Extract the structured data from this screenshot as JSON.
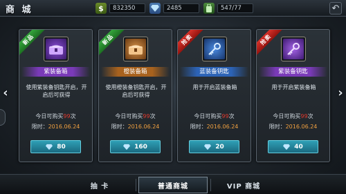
{
  "header": {
    "title": "商 城",
    "gold": "832350",
    "gems": "2485",
    "bag": "547/77",
    "gold_icon": "dollar-icon",
    "gem_icon": "diamond-icon",
    "bag_icon": "bag-icon",
    "close_glyph": "↶"
  },
  "cards": [
    {
      "ribbon": "新品",
      "name": "紫装备箱",
      "desc": "使用紫装备钥匙开启，开启后可获得",
      "quota_prefix": "今日可购买",
      "quota_num": "99",
      "quota_suffix": "次",
      "limit_label": "限时：",
      "limit_date": "2016.06.24",
      "price": "80"
    },
    {
      "ribbon": "新品",
      "name": "橙装备箱",
      "desc": "使用橙装备钥匙开启，开启后可获得",
      "quota_prefix": "今日可购买",
      "quota_num": "99",
      "quota_suffix": "次",
      "limit_label": "限时：",
      "limit_date": "2016.06.24",
      "price": "160"
    },
    {
      "ribbon": "抢卖",
      "name": "蓝装备钥匙",
      "desc": "用于开启蓝装备箱",
      "quota_prefix": "今日可购买",
      "quota_num": "99",
      "quota_suffix": "次",
      "limit_label": "限时：",
      "limit_date": "2016.06.24",
      "price": "20"
    },
    {
      "ribbon": "抢卖",
      "name": "紫装备钥匙",
      "desc": "用于开启紫装备箱",
      "quota_prefix": "今日可购买",
      "quota_num": "99",
      "quota_suffix": "次",
      "limit_label": "限时：",
      "limit_date": "2016.06.24",
      "price": "40"
    }
  ],
  "tabs": {
    "draw": "抽 卡",
    "normal": "普通商城",
    "vip": "VIP 商城"
  },
  "colors": {
    "new_ribbon": "#2b9a33",
    "sale_ribbon": "#c82820",
    "buy_button": "#2a8ca2",
    "quota_number": "#e23a2e"
  }
}
